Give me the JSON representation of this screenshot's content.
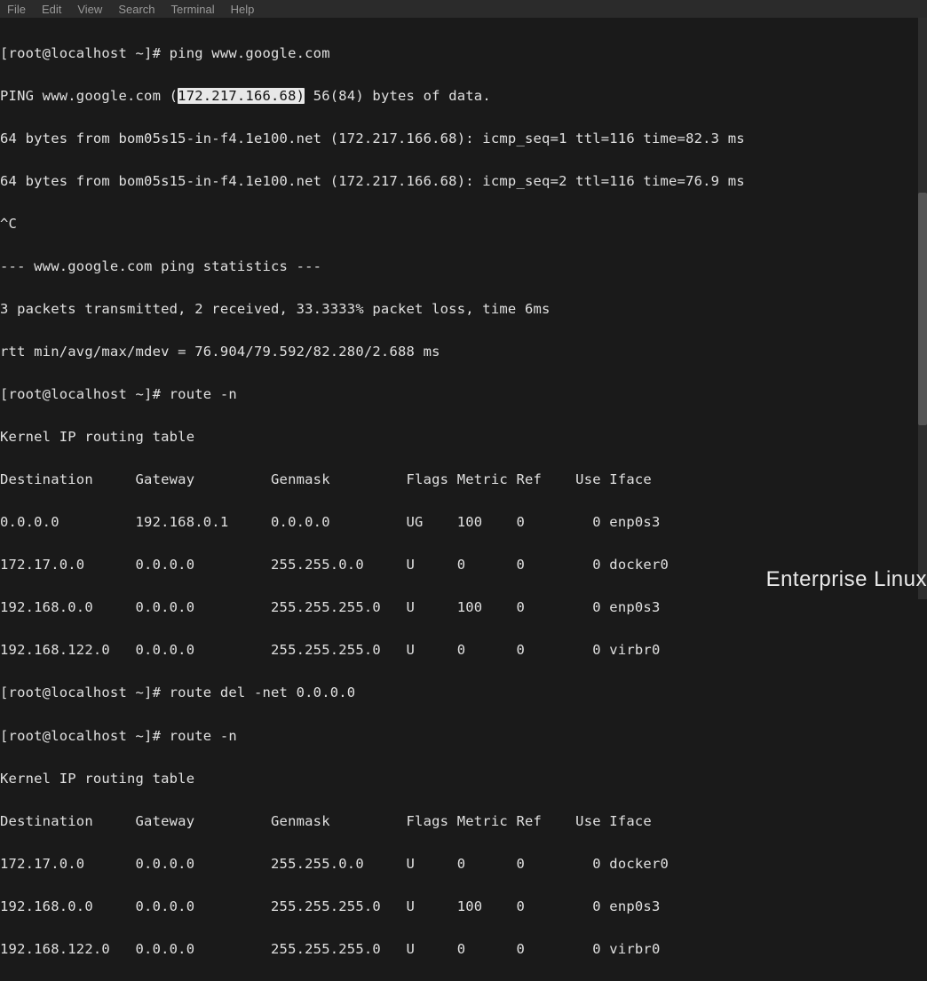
{
  "menubar": {
    "items": [
      "File",
      "Edit",
      "View",
      "Search",
      "Terminal",
      "Help"
    ]
  },
  "prompt": "[root@localhost ~]# ",
  "cmd1": "ping www.google.com",
  "ping_header_a": "PING www.google.com (",
  "ping_ip": "172.217.166.68)",
  "ping_header_b": " 56(84) bytes of data.",
  "ping_resp1": "64 bytes from bom05s15-in-f4.1e100.net (172.217.166.68): icmp_seq=1 ttl=116 time=82.3 ms",
  "ping_resp2": "64 bytes from bom05s15-in-f4.1e100.net (172.217.166.68): icmp_seq=2 ttl=116 time=76.9 ms",
  "ctrlc": "^C",
  "stats_hdr": "--- www.google.com ping statistics ---",
  "stats_line1": "3 packets transmitted, 2 received, 33.3333% packet loss, time 6ms",
  "stats_line2": "rtt min/avg/max/mdev = 76.904/79.592/82.280/2.688 ms",
  "cmd2": "route -n",
  "route_title": "Kernel IP routing table",
  "route_hdr": "Destination     Gateway         Genmask         Flags Metric Ref    Use Iface",
  "route1_rows": [
    "0.0.0.0         192.168.0.1     0.0.0.0         UG    100    0        0 enp0s3",
    "172.17.0.0      0.0.0.0         255.255.0.0     U     0      0        0 docker0",
    "192.168.0.0     0.0.0.0         255.255.255.0   U     100    0        0 enp0s3",
    "192.168.122.0   0.0.0.0         255.255.255.0   U     0      0        0 virbr0"
  ],
  "cmd3": "route del -net 0.0.0.0",
  "cmd4": "route -n",
  "route2_rows": [
    "172.17.0.0      0.0.0.0         255.255.0.0     U     0      0        0 docker0",
    "192.168.0.0     0.0.0.0         255.255.255.0   U     100    0        0 enp0s3",
    "192.168.122.0   0.0.0.0         255.255.255.0   U     0      0        0 virbr0"
  ],
  "watermark": "Enterprise Linux"
}
